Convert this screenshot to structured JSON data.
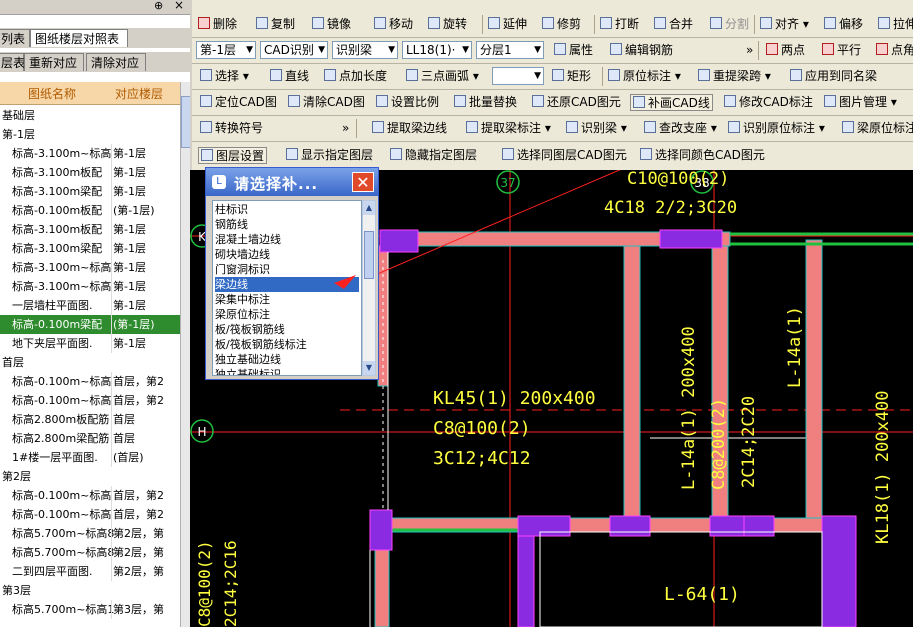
{
  "left_panel": {
    "tab_row1": [
      {
        "label": "列表"
      },
      {
        "label": "图纸楼层对照表"
      }
    ],
    "tab_row2": [
      {
        "label": "层表"
      },
      {
        "label": "重新对应"
      },
      {
        "label": "清除对应"
      }
    ],
    "columns": {
      "name": "图纸名称",
      "floor": "对应楼层"
    },
    "rows": [
      {
        "name": "基础层",
        "floor": ""
      },
      {
        "name": "第-1层",
        "floor": ""
      },
      {
        "name": "标高-3.100m~标高",
        "floor": "第-1层"
      },
      {
        "name": "标高-3.100m板配",
        "floor": "第-1层"
      },
      {
        "name": "标高-3.100m梁配",
        "floor": "第-1层"
      },
      {
        "name": "标高-0.100m板配",
        "floor": "(第-1层)"
      },
      {
        "name": "标高-3.100m板配",
        "floor": "第-1层"
      },
      {
        "name": "标高-3.100m梁配",
        "floor": "第-1层"
      },
      {
        "name": "标高-3.100m~标高",
        "floor": "第-1层"
      },
      {
        "name": "标高-3.100m~标高",
        "floor": "第-1层"
      },
      {
        "name": "一层墙柱平面图.",
        "floor": "第-1层"
      },
      {
        "name": "标高-0.100m梁配",
        "floor": "(第-1层)"
      },
      {
        "name": "地下夹层平面图.",
        "floor": "第-1层"
      },
      {
        "name": "首层",
        "floor": ""
      },
      {
        "name": "标高-0.100m~标高",
        "floor": "首层，第2"
      },
      {
        "name": "标高-0.100m~标高",
        "floor": "首层，第2"
      },
      {
        "name": "标高2.800m板配筋",
        "floor": "首层"
      },
      {
        "name": "标高2.800m梁配筋",
        "floor": "首层"
      },
      {
        "name": "1#楼一层平面图.",
        "floor": "(首层)"
      },
      {
        "name": "第2层",
        "floor": ""
      },
      {
        "name": "标高-0.100m~标高",
        "floor": "首层，第2"
      },
      {
        "name": "标高-0.100m~标高",
        "floor": "首层，第2"
      },
      {
        "name": "标高5.700m~标高8",
        "floor": "第2层，第"
      },
      {
        "name": "标高5.700m~标高8",
        "floor": "第2层，第"
      },
      {
        "name": "二到四层平面图.",
        "floor": "第2层，第"
      },
      {
        "name": "第3层",
        "floor": ""
      },
      {
        "name": "标高5.700m~标高1",
        "floor": "第3层，第"
      }
    ]
  },
  "toolbar": {
    "row1": [
      "删除",
      "复制",
      "镜像",
      "移动",
      "旋转",
      "延伸",
      "修剪",
      "打断",
      "合并",
      "分割",
      "对齐",
      "偏移",
      "拉伸"
    ],
    "row2": {
      "floor_select": "第-1层",
      "mode_select": "CAD识别",
      "component_select": "识别梁",
      "beam_select": "LL18(1)·",
      "layer_select": "分层1",
      "buttons": [
        "属性",
        "编辑钢筋",
        "两点",
        "平行",
        "点角"
      ]
    },
    "row3": [
      "选择",
      "直线",
      "点加长度",
      "三点画弧",
      "矩形",
      "原位标注",
      "重提梁跨",
      "应用到同名梁"
    ],
    "row4": [
      "定位CAD图",
      "清除CAD图",
      "设置比例",
      "批量替换",
      "还原CAD图元",
      "补画CAD线",
      "修改CAD标注",
      "图片管理"
    ],
    "row5": [
      "转换符号",
      "提取梁边线",
      "提取梁标注",
      "识别梁",
      "查改支座",
      "识别原位标注",
      "梁原位标注"
    ],
    "row6": [
      "图层设置",
      "显示指定图层",
      "隐藏指定图层",
      "选择同图层CAD图元",
      "选择同颜色CAD图元"
    ]
  },
  "dialog": {
    "title": "请选择补...",
    "items": [
      "柱标识",
      "钢筋线",
      "混凝土墙边线",
      "砌块墙边线",
      "门窗洞标识",
      "梁边线",
      "梁集中标注",
      "梁原位标注",
      "板/筏板钢筋线",
      "板/筏板钢筋线标注",
      "独立基础边线",
      "独立基础标识"
    ],
    "selected_index": 5
  },
  "cad": {
    "texts": {
      "top1": "C10@100(2)",
      "top2": "4C18 2/2;3C20",
      "kl45_1": "KL45(1) 200x400",
      "kl45_2": "C8@100(2)",
      "kl45_3": "3C12;4C12",
      "l14a_a": "L-14a(1) 200x400",
      "l14a_b": "C8@200(2)",
      "l14a_c": "2C14;2C20",
      "l14a_right": "L-14a(1)",
      "kl18": "KL18(1) 200x400",
      "l64": "L-64(1)",
      "left1": "C8@100(2)",
      "left2": "2C14;2C16",
      "axis_k": "K",
      "axis_h": "H",
      "axis_37": "37",
      "axis_38": "38"
    }
  },
  "colors": {
    "cad_bg": "#000000",
    "beam_fill": "#f08080",
    "column_fill": "#8a2be2",
    "text_yellow": "#ffff40",
    "grid_red": "#ff2020",
    "edge_green": "#20c040",
    "selection_blue": "#316ac5"
  }
}
